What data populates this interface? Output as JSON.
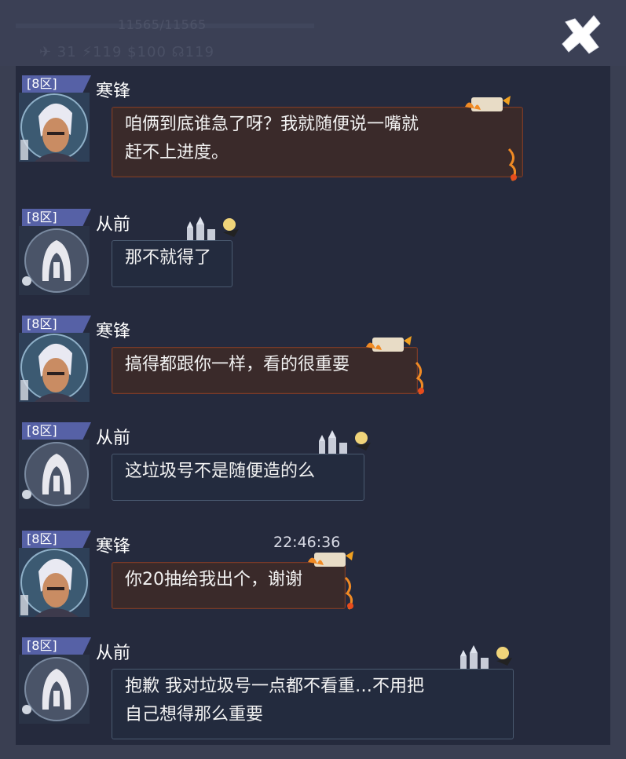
{
  "header": {
    "hp_text": "11565/11565",
    "stats_text": "✈ 31  ⚡119  $100  ☊119"
  },
  "icons": {
    "close": "close-x-icon",
    "avatar_hanfeng": "white-haired-warrior-avatar",
    "avatar_congqian": "hooded-figure-avatar",
    "fire_scroll": "fire-scroll-decoration",
    "castle": "castle-decoration"
  },
  "colors": {
    "panel_bg": "#252a3d",
    "tag_bg": "#5661a6",
    "fire_bubble_bg": "#3a2a2a",
    "castle_bubble_bg": "#232b3e"
  },
  "messages": [
    {
      "tag": "[8区]",
      "name": "寒锋",
      "style": "fire",
      "time": "",
      "lines": [
        "咱俩到底谁急了呀？我就随便说一嘴就",
        "赶不上进度。"
      ]
    },
    {
      "tag": "[8区]",
      "name": "从前",
      "style": "castle",
      "time": "",
      "lines": [
        "那不就得了"
      ]
    },
    {
      "tag": "[8区]",
      "name": "寒锋",
      "style": "fire",
      "time": "",
      "lines": [
        "搞得都跟你一样，看的很重要"
      ]
    },
    {
      "tag": "[8区]",
      "name": "从前",
      "style": "castle",
      "time": "",
      "lines": [
        "这垃圾号不是随便造的么"
      ]
    },
    {
      "tag": "[8区]",
      "name": "寒锋",
      "style": "fire",
      "time": "22:46:36",
      "lines": [
        "你20抽给我出个，谢谢"
      ]
    },
    {
      "tag": "[8区]",
      "name": "从前",
      "style": "castle",
      "time": "",
      "lines": [
        "抱歉 我对垃圾号一点都不看重…不用把",
        "自己想得那么重要"
      ]
    }
  ]
}
